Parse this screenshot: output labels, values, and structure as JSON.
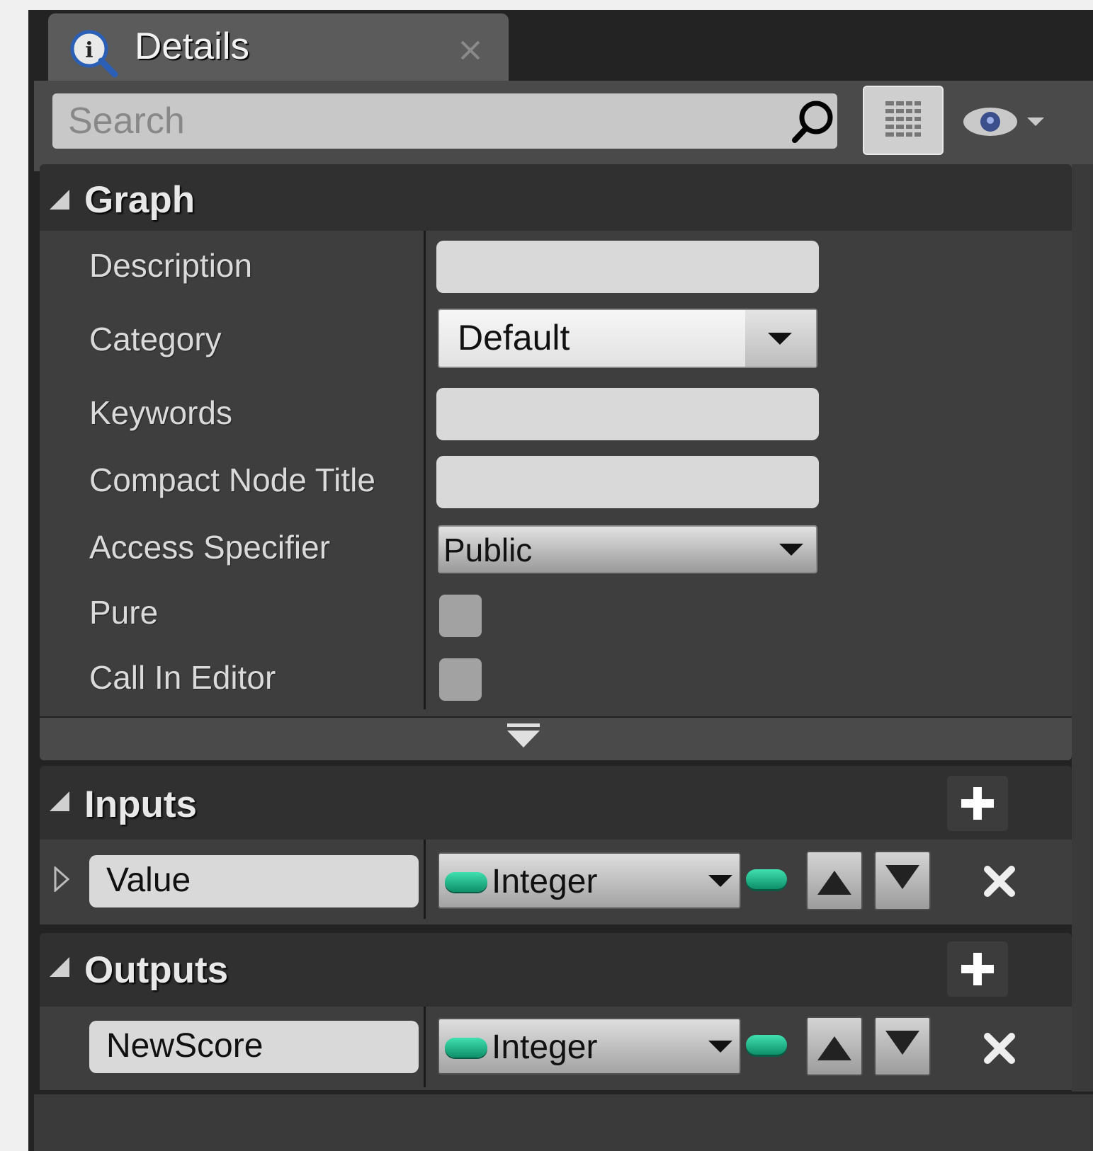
{
  "tab": {
    "title": "Details",
    "icon": "info-magnifier-icon",
    "close_icon": "close-icon"
  },
  "toolbar": {
    "search_placeholder": "Search",
    "search_icon": "search-icon",
    "view_options_icon": "grid-view-icon",
    "visibility_icon": "eye-icon"
  },
  "graph": {
    "title": "Graph",
    "properties": [
      {
        "label": "Description",
        "value": ""
      },
      {
        "label": "Category",
        "value": "Default"
      },
      {
        "label": "Keywords",
        "value": ""
      },
      {
        "label": "Compact Node Title",
        "value": ""
      },
      {
        "label": "Access Specifier",
        "value": "Public"
      },
      {
        "label": "Pure",
        "checked": false
      },
      {
        "label": "Call In Editor",
        "checked": false
      }
    ],
    "advanced_icon": "show-advanced-icon"
  },
  "inputs": {
    "title": "Inputs",
    "items": [
      {
        "name": "Value",
        "type": "Integer",
        "type_color": "#1fbf8f"
      }
    ]
  },
  "outputs": {
    "title": "Outputs",
    "items": [
      {
        "name": "NewScore",
        "type": "Integer",
        "type_color": "#1fbf8f"
      }
    ]
  },
  "colors": {
    "panel": "#232323",
    "header": "#303030",
    "body": "#3e3e3e",
    "integer_pin": "#1fbf8f"
  }
}
